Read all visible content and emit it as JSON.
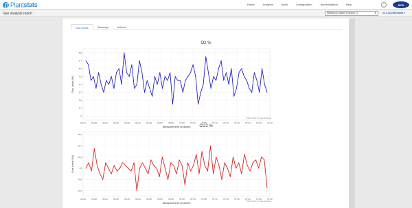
{
  "app": {
    "logo_prefix": "Plant",
    "logo_suffix": "stats",
    "logo_sub": "a Plant service",
    "brand_badge": "BCS"
  },
  "nav": {
    "items": [
      "Home",
      "Analysis",
      "Audit",
      "Configuration",
      "Administration",
      "Help"
    ]
  },
  "subbar": {
    "page_title": "Gas analysis report",
    "site_select": "Marston in Marsh (Factory 1)",
    "version": "v1.1.12.2035 Build ▾"
  },
  "tabs": [
    {
      "label": "Gas levels",
      "active": true
    },
    {
      "label": "Warnings",
      "active": false
    },
    {
      "label": "Actions",
      "active": false
    }
  ],
  "colors": {
    "o2_line": "#2222cc",
    "co2_line": "#e02020",
    "accent": "#2a8fd6"
  },
  "chart_data": [
    {
      "type": "line",
      "title": "O2 %",
      "xlabel": "Measurement received",
      "ylabel": "Gas Level (%)",
      "ylim": [
        4.95,
        5.85
      ],
      "yticks": [
        "5.8",
        "5.7",
        "5.6",
        "5.5",
        "5.4",
        "5.3",
        "5.2",
        "5.1",
        "5"
      ],
      "xticks": [
        "06:24",
        "06:28",
        "06:32",
        "06:36",
        "06:40",
        "06:44",
        "06:48",
        "06:52",
        "06:56",
        "07:00",
        "07:04",
        "07:08",
        "07:12",
        "07:16",
        "07:20",
        "07:24",
        "07:28",
        "07:32"
      ],
      "credit": "PHP Chart: 5 Gas Analysis",
      "series": [
        {
          "values": [
            5.7,
            5.65,
            5.45,
            5.5,
            5.35,
            5.55,
            5.4,
            5.3,
            5.45,
            5.4,
            5.5,
            5.35,
            5.55,
            5.6,
            5.4,
            5.8,
            5.55,
            5.5,
            5.65,
            5.35,
            5.4,
            5.7,
            5.55,
            5.3,
            5.45,
            5.35,
            5.25,
            5.5,
            5.4,
            5.55,
            5.35,
            5.5,
            5.45,
            5.55,
            5.15,
            5.5,
            5.45,
            5.45,
            5.3,
            5.45,
            5.5,
            5.55,
            5.65,
            5.5,
            5.15,
            5.3,
            5.4,
            5.75,
            5.55,
            5.35,
            5.5,
            5.45,
            5.6,
            5.7,
            5.45,
            5.55,
            5.4,
            5.6,
            5.25,
            5.35,
            5.55,
            5.6,
            5.5,
            5.45,
            5.35,
            5.3,
            5.55,
            5.45,
            5.3,
            5.6,
            5.4,
            5.3
          ]
        }
      ]
    },
    {
      "type": "line",
      "title": "CO2 %",
      "xlabel": "Measurement received",
      "ylabel": "Gas Level (%)",
      "ylim": [
        24.5,
        25.65
      ],
      "yticks": [
        "25.6",
        "25.4",
        "25.2",
        "25",
        "24.8",
        "24.6"
      ],
      "xticks": [
        "06:24",
        "06:28",
        "06:32",
        "06:36",
        "06:40",
        "06:44",
        "06:48",
        "06:52",
        "06:56",
        "07:00",
        "07:04",
        "07:08",
        "07:12",
        "07:16",
        "07:20",
        "07:24",
        "07:28",
        "07:32"
      ],
      "credit": "PHP Chart: 5 Gas Analysis",
      "series": [
        {
          "values": [
            25.0,
            25.1,
            24.95,
            25.35,
            25.05,
            24.9,
            24.8,
            25.1,
            25.0,
            24.9,
            25.05,
            24.95,
            25.0,
            25.1,
            25.05,
            25.0,
            24.95,
            25.1,
            24.6,
            25.0,
            25.1,
            25.0,
            24.9,
            25.15,
            25.05,
            25.0,
            24.85,
            25.2,
            25.0,
            24.8,
            25.1,
            25.05,
            24.9,
            25.15,
            25.05,
            24.7,
            25.1,
            24.95,
            25.05,
            25.25,
            24.9,
            25.3,
            25.05,
            24.95,
            25.4,
            24.9,
            25.2,
            25.05,
            24.8,
            25.1,
            25.0,
            24.85,
            25.2,
            25.0,
            25.1,
            24.9,
            25.25,
            25.05,
            24.95,
            25.1,
            25.15,
            25.0,
            25.2,
            25.15,
            24.65
          ]
        }
      ]
    }
  ]
}
